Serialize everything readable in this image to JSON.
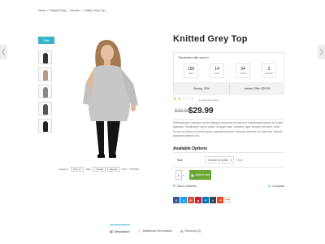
{
  "breadcrumb": {
    "items": [
      "Home",
      "Default Shop",
      "Women",
      "Knitted Grey Top"
    ],
    "separator": "/"
  },
  "gallery": {
    "badge": "Sale",
    "meta": {
      "category_label": "Category:",
      "category": "Women",
      "tags_label": "Tags:",
      "tags": [
        "Casual",
        "Elegant"
      ],
      "sku_label": "SKU:",
      "sku": "7752659"
    }
  },
  "product": {
    "title": "Knitted Grey Top",
    "offer": {
      "label": "This limited offer ends in",
      "countdown": [
        {
          "value": "156",
          "unit": "days"
        },
        {
          "value": "14",
          "unit": "hours"
        },
        {
          "value": "34",
          "unit": "minutes"
        },
        {
          "value": "2",
          "unit": "seconds"
        }
      ],
      "saving": "Saving: 25%",
      "after_price": "Instant Offer: $29.99"
    },
    "rating": {
      "value": 2,
      "max": 5,
      "reviews_text": "1 customer review"
    },
    "old_price": "$39.99",
    "price": "$29.99",
    "description": "Pellentesque habitant morbi tristique senectus et netus et malesuada fames ac turpis egestas. Vestibulum tortor quam, feugiat vitae, ultricies eget, tempor sit amet, ante. Donec eu libero sit amet quam egestas semper. Aenean ultricies mi vitae est. Mauris placerat eleifend leo.",
    "options": {
      "title": "Available Options",
      "size_label": "Size",
      "size_placeholder": "Choose an option",
      "clear": "Clear"
    },
    "quantity": "1",
    "add_to_cart": "Add to cart",
    "wishlist": "Add to Wishlist",
    "compare": "Compare",
    "share": [
      "f",
      "t",
      "g+",
      "p",
      "in",
      "t",
      "su",
      "reddit"
    ]
  },
  "tabs": [
    {
      "label": "Description",
      "icon": "document-icon"
    },
    {
      "label": "Additional Information",
      "icon": "info-icon"
    },
    {
      "label": "Reviews (2)",
      "icon": "chat-icon"
    }
  ],
  "colors": {
    "accent": "#3ab3ca",
    "cart_green": "#6ba736",
    "star": "#f2b01e"
  }
}
